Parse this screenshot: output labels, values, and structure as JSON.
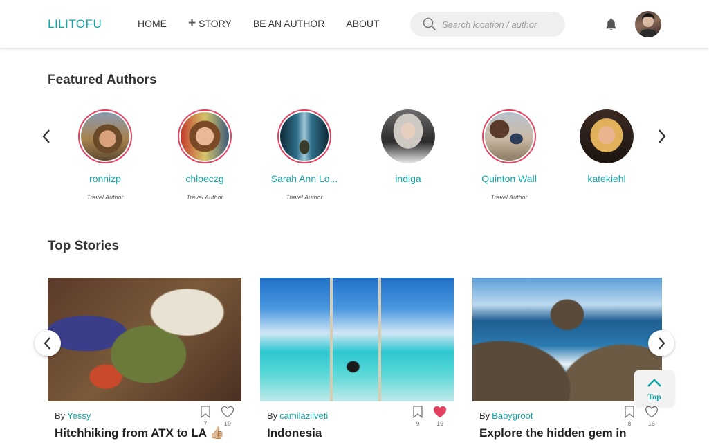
{
  "header": {
    "logo": "LILITOFU",
    "nav": [
      {
        "label": "HOME",
        "icon": ""
      },
      {
        "label": "STORY",
        "icon": "plus-icon"
      },
      {
        "label": "BE AN AUTHOR",
        "icon": ""
      },
      {
        "label": "ABOUT",
        "icon": ""
      }
    ],
    "search_placeholder": "Search location / author"
  },
  "featured": {
    "title": "Featured Authors",
    "authors": [
      {
        "name": "ronnizp",
        "role": "Travel Author"
      },
      {
        "name": "chloeczg",
        "role": "Travel Author"
      },
      {
        "name": "Sarah Ann Lo...",
        "role": "Travel Author"
      },
      {
        "name": "indiga",
        "role": ""
      },
      {
        "name": "Quinton Wall",
        "role": "Travel Author"
      },
      {
        "name": "katekiehl",
        "role": ""
      }
    ]
  },
  "top_stories": {
    "title": "Top Stories",
    "by_label": "By",
    "stories": [
      {
        "author": "Yessy",
        "title": "Hitchhiking from ATX to LA 👍🏼",
        "bookmarks": "7",
        "likes": "19",
        "liked": false
      },
      {
        "author": "camilazilveti",
        "title": "Indonesia",
        "bookmarks": "9",
        "likes": "19",
        "liked": true
      },
      {
        "author": "Babygroot",
        "title": "Explore the hidden gem in",
        "bookmarks": "8",
        "likes": "16",
        "liked": false
      }
    ]
  },
  "top_button": "Top",
  "colors": {
    "accent": "#14a6a6",
    "ring": "#e4405f",
    "like": "#e4405f"
  }
}
